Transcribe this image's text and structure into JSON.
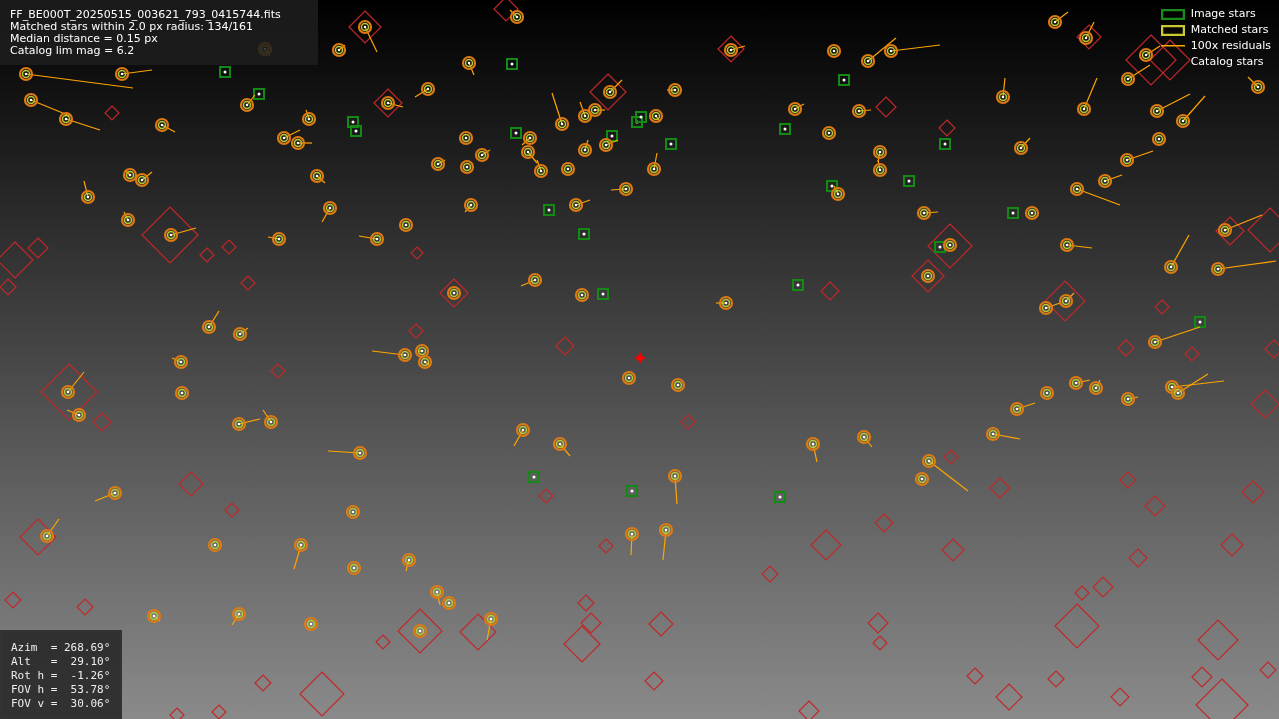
{
  "file_info": {
    "lines": [
      "FF_BE000T_20250515_003621_793_0415744.fits",
      "Matched stars within 2.0 px radius: 134/161",
      "Median distance = 0.15 px",
      "Catalog lim mag = 6.2"
    ]
  },
  "legend": [
    {
      "label": "Image stars",
      "kind": "image"
    },
    {
      "label": "Matched stars",
      "kind": "matched"
    },
    {
      "label": "100x residuals",
      "kind": "residual"
    },
    {
      "label": "Catalog stars",
      "kind": "catalog"
    }
  ],
  "pointing": {
    "lines": [
      "Azim  = 268.69°",
      "Alt   =  29.10°",
      "Rot h =  -1.26°",
      "FOV h =  53.78°",
      "FOV v =  30.06°"
    ]
  }
}
